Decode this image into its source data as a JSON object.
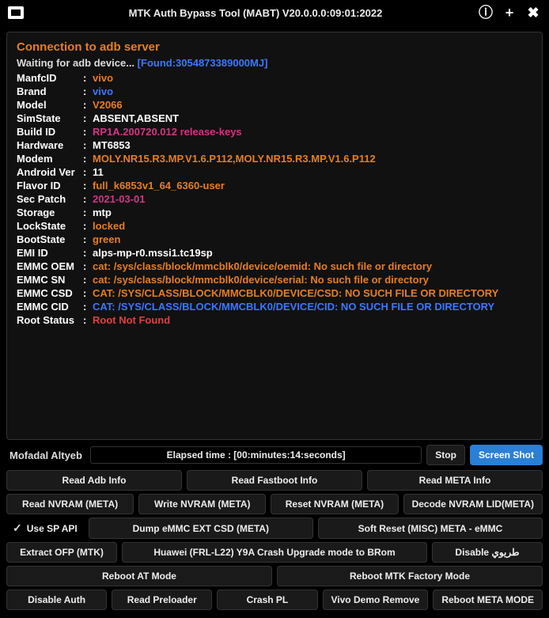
{
  "titlebar": {
    "title": "MTK Auth Bypass Tool (MABT) V20.0.0.0:09:01:2022"
  },
  "log": {
    "heading": "Connection to adb server",
    "waiting_text": "Waiting for adb device...",
    "found_text": "[Found:3054873389000MJ]",
    "rows": [
      {
        "key": "ManfcID",
        "val": "vivo",
        "color": "c-orange"
      },
      {
        "key": "Brand",
        "val": "vivo",
        "color": "c-blue"
      },
      {
        "key": "Model",
        "val": "V2066",
        "color": "c-orange"
      },
      {
        "key": "SimState",
        "val": "ABSENT,ABSENT",
        "color": "c-white"
      },
      {
        "key": "Build ID",
        "val": "RP1A.200720.012 release-keys",
        "color": "c-magenta"
      },
      {
        "key": "Hardware",
        "val": "MT6853",
        "color": "c-white"
      },
      {
        "key": "Modem",
        "val": "MOLY.NR15.R3.MP.V1.6.P112,MOLY.NR15.R3.MP.V1.6.P112",
        "color": "c-orange"
      },
      {
        "key": "Android Ver",
        "val": "11",
        "color": "c-white"
      },
      {
        "key": "Flavor ID",
        "val": "full_k6853v1_64_6360-user",
        "color": "c-orange"
      },
      {
        "key": "Sec Patch",
        "val": "2021-03-01",
        "color": "c-magenta"
      },
      {
        "key": "Storage",
        "val": "mtp",
        "color": "c-white"
      },
      {
        "key": "LockState",
        "val": "locked",
        "color": "c-orange"
      },
      {
        "key": "BootState",
        "val": "green",
        "color": "c-orange"
      },
      {
        "key": "EMI ID",
        "val": "alps-mp-r0.mssi1.tc19sp",
        "color": "c-white"
      },
      {
        "key": "EMMC OEM",
        "val": "cat: /sys/class/block/mmcblk0/device/oemid: No such file or directory",
        "color": "c-orange"
      },
      {
        "key": "EMMC SN",
        "val": "cat: /sys/class/block/mmcblk0/device/serial: No such file or directory",
        "color": "c-orange"
      },
      {
        "key": "EMMC CSD",
        "val": "CAT: /SYS/CLASS/BLOCK/MMCBLK0/DEVICE/CSD: NO SUCH FILE OR DIRECTORY",
        "color": "c-orange"
      },
      {
        "key": "EMMC CID",
        "val": "CAT: /SYS/CLASS/BLOCK/MMCBLK0/DEVICE/CID: NO SUCH FILE OR DIRECTORY",
        "color": "c-blue"
      },
      {
        "key": "Root Status",
        "val": "Root Not Found",
        "color": "c-red"
      }
    ]
  },
  "footer": {
    "dev_name": "Mofadal Altyeb",
    "elapsed": "Elapsed time : [00:minutes:14:seconds]",
    "stop": "Stop",
    "screenshot": "Screen Shot"
  },
  "buttons": {
    "row1": [
      "Read Adb Info",
      "Read Fastboot Info",
      "Read META Info"
    ],
    "row2": [
      "Read NVRAM (META)",
      "Write NVRAM (META)",
      "Reset NVRAM (META)",
      "Decode NVRAM LID(META)"
    ],
    "check_label": "Use SP API",
    "row3": [
      "Dump eMMC EXT CSD (META)",
      "Soft Reset (MISC) META - eMMC"
    ],
    "row4": [
      "Extract OFP (MTK)",
      "Huawei (FRL-L22) Y9A Crash Upgrade mode to BRom",
      "Disable طريوي"
    ],
    "row5": [
      "Reboot  AT Mode",
      "Reboot MTK Factory Mode"
    ],
    "row6": [
      "Disable Auth",
      "Read Preloader",
      "Crash PL",
      "Vivo Demo Remove",
      "Reboot META MODE"
    ]
  }
}
